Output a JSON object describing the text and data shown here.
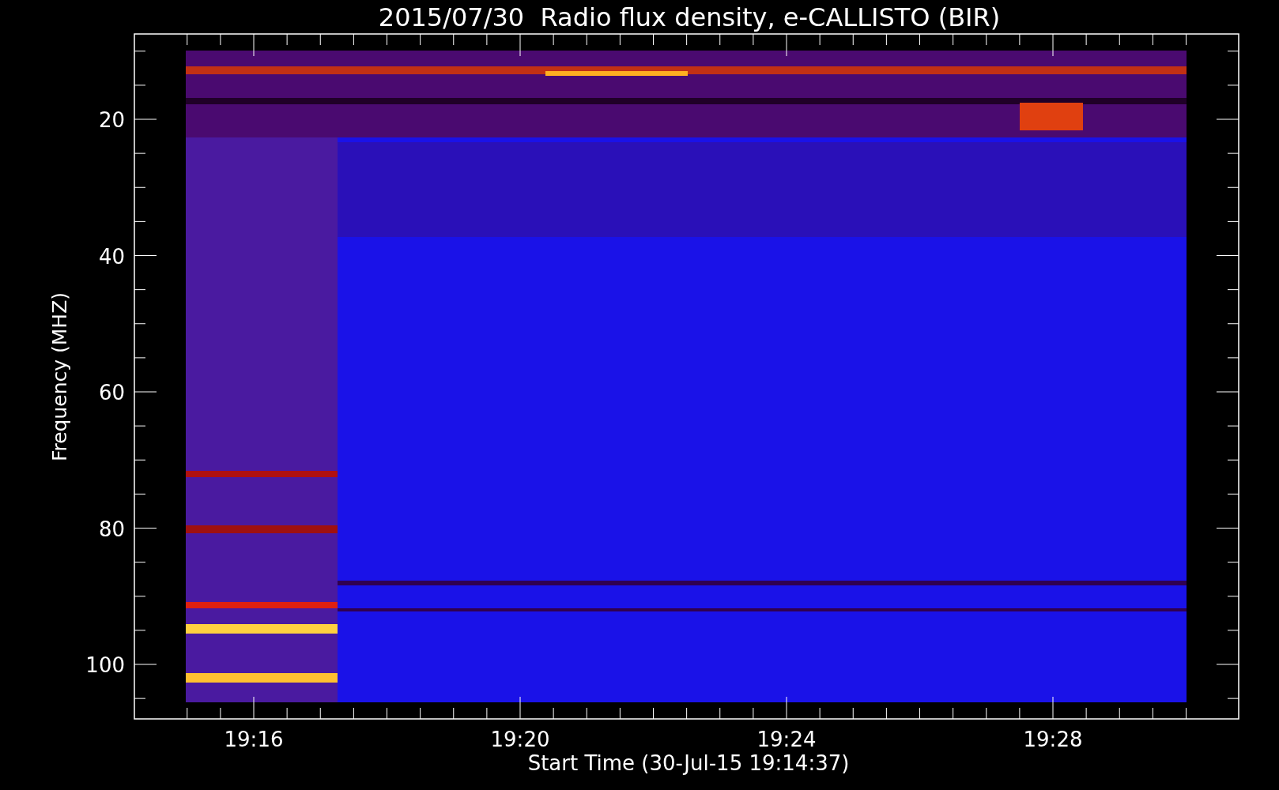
{
  "chart": {
    "title": "2015/07/30  Radio flux density, e-CALLISTO (BIR)",
    "ylabel": "Frequency (MHZ)",
    "xlabel": "Start Time (30-Jul-15 19:14:37)",
    "yticks": [
      "20",
      "40",
      "60",
      "80",
      "100"
    ],
    "xticks": [
      "19:16",
      "19:20",
      "19:24",
      "19:28"
    ]
  }
}
